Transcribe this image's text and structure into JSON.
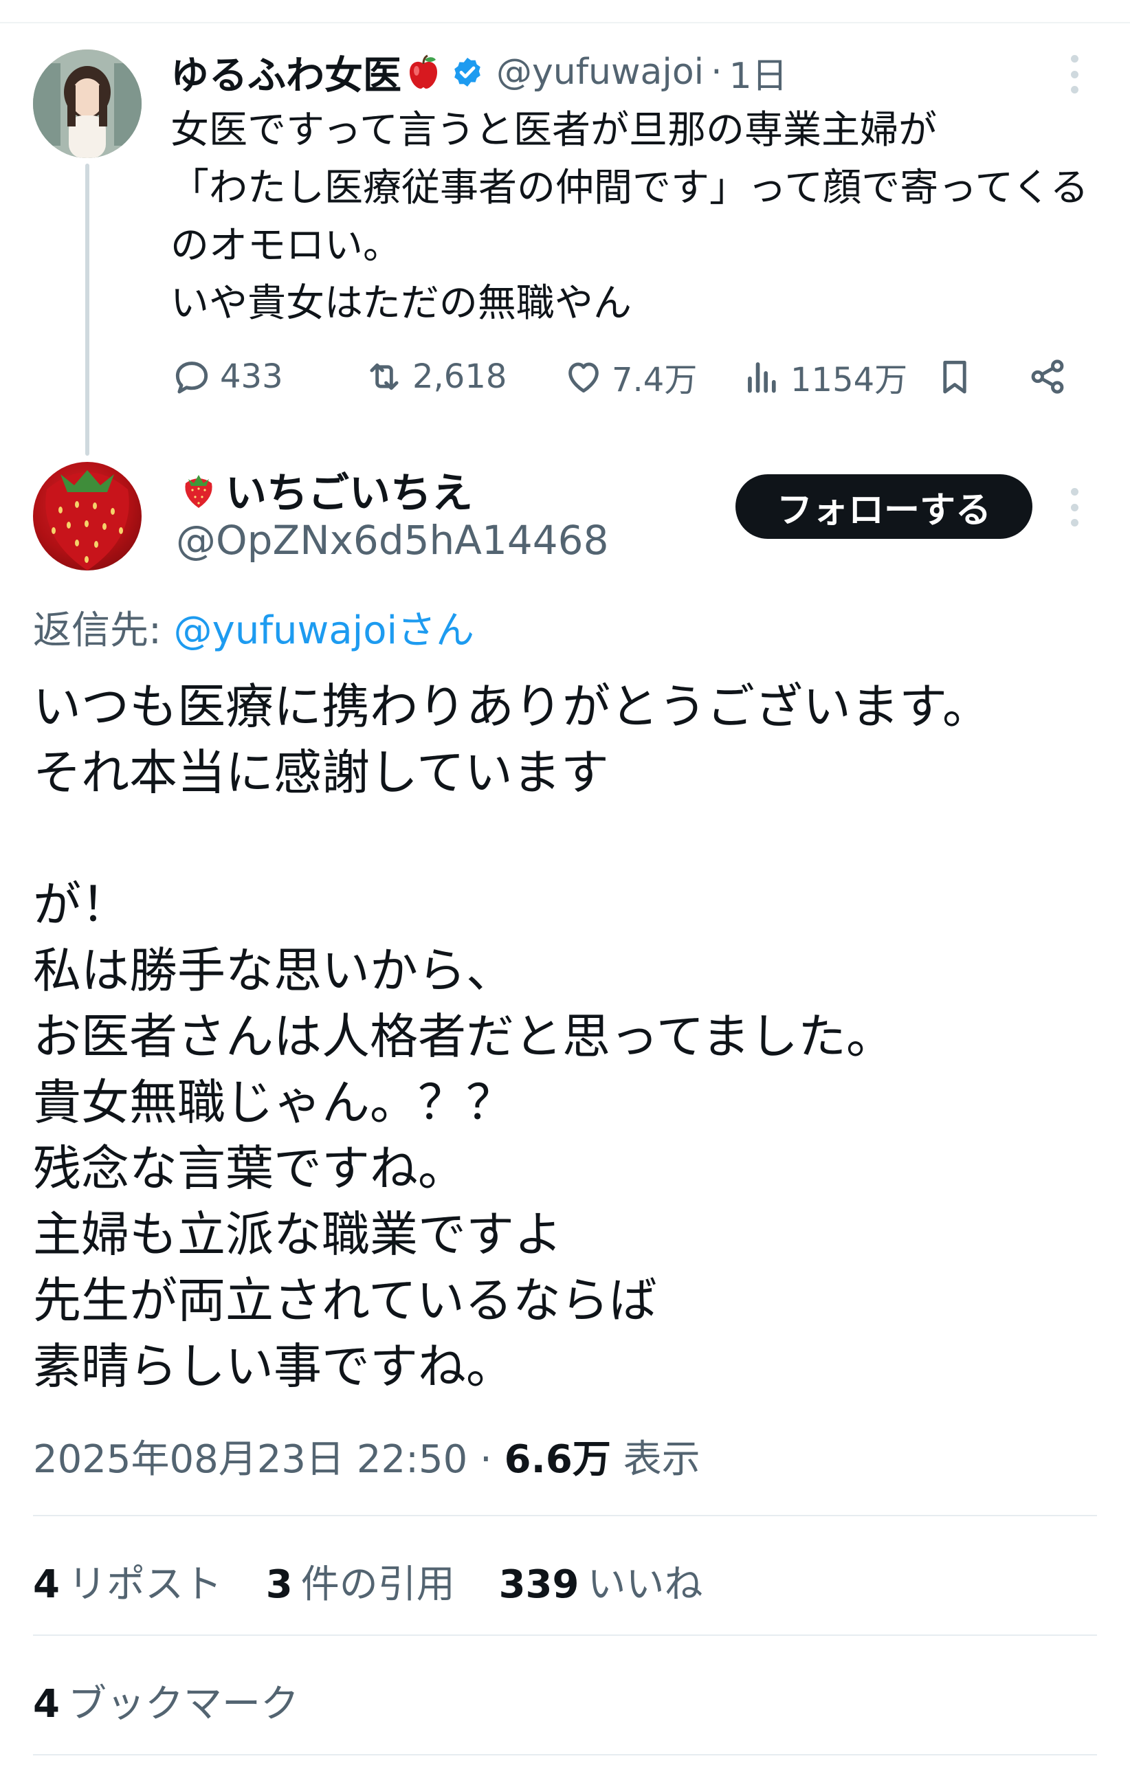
{
  "original_tweet": {
    "display_name": "ゆるふわ女医",
    "handle": "@yufuwajoi",
    "separator": "·",
    "time": "1日",
    "text": "女医ですって言うと医者が旦那の専業主婦が\n「わたし医療従事者の仲間です」って顔で寄ってくるのオモロい。\nいや貴女はただの無職やん",
    "actions": {
      "replies": "433",
      "retweets": "2,618",
      "likes": "7.4万",
      "views": "1154万"
    },
    "icons": [
      "apple-emoji-icon",
      "verified-badge-icon",
      "more-options-icon",
      "reply-icon",
      "retweet-icon",
      "like-icon",
      "views-icon",
      "bookmark-icon",
      "share-icon"
    ]
  },
  "reply_tweet": {
    "display_name": "いちごいちえ",
    "handle": "@OpZNx6d5hA14468",
    "follow_label": "フォローする",
    "reply_to_prefix": "返信先: ",
    "reply_to_handle": "@yufuwajoiさん",
    "text": "いつも医療に携わりありがとうございます。\nそれ本当に感謝しています\n\nが！\n私は勝手な思いから、\nお医者さんは人格者だと思ってました。\n貴女無職じゃん。？？\n残念な言葉ですね。\n主婦も立派な職業ですよ\n先生が両立されているならば\n素晴らしい事ですね。",
    "timestamp": "2025年08月23日 22:50",
    "meta_separator": " · ",
    "views_count": "6.6万",
    "views_label": " 表示",
    "stats": {
      "reposts_count": "4",
      "reposts_label": "リポスト",
      "quotes_count": "3",
      "quotes_label": "件の引用",
      "likes_count": "339",
      "likes_label": "いいね",
      "bookmarks_count": "4",
      "bookmarks_label": "ブックマーク"
    }
  },
  "colors": {
    "text_primary": "#0f1419",
    "text_secondary": "#536471",
    "link": "#1d9bf0",
    "verified": "#1d9bf0",
    "follow_button_bg": "#0f1419",
    "divider": "#e6ecf0"
  }
}
